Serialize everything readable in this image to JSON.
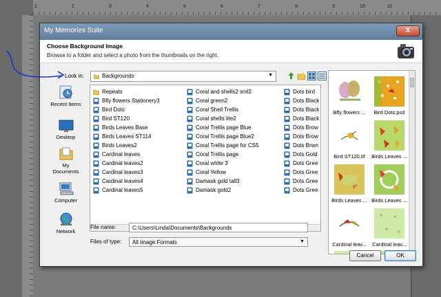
{
  "ruler": {
    "numbers": [
      "1",
      "2",
      "3",
      "4",
      "5",
      "6",
      "7",
      "8",
      "9",
      "10",
      "11"
    ]
  },
  "dialog": {
    "title": "My Memories Suite",
    "close_label": "X",
    "header_title": "Choose Background Image",
    "header_subtitle": "Browse to a folder and select a photo from the thumbnails on the right.",
    "look_in_label": "Look in:",
    "look_in_value": "Backgrounds",
    "places": [
      "Recent Items",
      "Desktop",
      "My Documents",
      "Computer",
      "Network"
    ],
    "files": {
      "col1": [
        "Repeats",
        "Bfly flowers Stationery3",
        "Bird Dots",
        "Bird ST120",
        "Birds Leaves Base",
        "Birds Leaves ST114",
        "Birds Leaves2",
        "Cardinal leaves",
        "Cardinal leaves2",
        "Cardinal leaves3",
        "Cardinal leaves4",
        "Cardinal leaves5"
      ],
      "col2": [
        "Coral and shells2 sml2",
        "Coral green2",
        "Coral Shell Trellis",
        "Coral shells lite2",
        "Coral Trellis page Blue",
        "Coral Trellis page Blue2",
        "Coral Trellis page for CS5",
        "Coral Trellis page",
        "Coral white 3",
        "Coral Yellow",
        "Damask gold tall3",
        "Damask gold2"
      ],
      "col3": [
        "Dots bird",
        "Dots Black",
        "Dots Black",
        "Dots Black",
        "Dots Brow",
        "Dots Brow",
        "Dots Brwn",
        "Dots Gold",
        "Dots Gree",
        "Dots Gree",
        "Dots Gree",
        "Dots Gree"
      ]
    },
    "thumbnails": [
      "Bfly flowers ...",
      "Bird Dots.psd",
      "Bird ST120.tif",
      "Birds Leaves ...",
      "Birds Leaves ...",
      "Birds Leaves ...",
      "Cardinal leav...",
      "Cardinal leav..."
    ],
    "file_name_label": "File name:",
    "file_name_value": "C:\\Users\\Linda\\Documents\\Backgrounds",
    "files_of_type_label": "Files of type:",
    "files_of_type_value": "All Image Formats",
    "cancel_label": "Cancel",
    "ok_label": "OK"
  },
  "colors": {
    "arrow": "#1a2fd1",
    "titlebar": "#6b89a8"
  }
}
